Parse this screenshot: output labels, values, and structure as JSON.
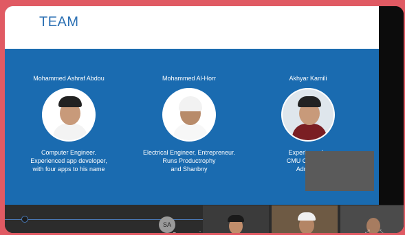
{
  "slide": {
    "title": "TEAM",
    "members": [
      {
        "name": "Mohammed Ashraf Abdou",
        "desc": [
          "Computer Engineer.",
          "Experienced app developer,",
          "with four apps to his name"
        ]
      },
      {
        "name": "Mohammed Al-Horr",
        "desc": [
          "Electrical Engineer, Entrepreneur.",
          "Runs Productrophy",
          "and Shanbny"
        ]
      },
      {
        "name": "Akhyar Kamili",
        "desc": [
          "Experienced s",
          "CMU Computer",
          "Administ"
        ]
      }
    ]
  },
  "participants": {
    "initials": "SA"
  },
  "colors": {
    "slide_blue": "#1a6bb0",
    "title_blue": "#2a6fb3",
    "frame_pink": "#e05a63"
  }
}
